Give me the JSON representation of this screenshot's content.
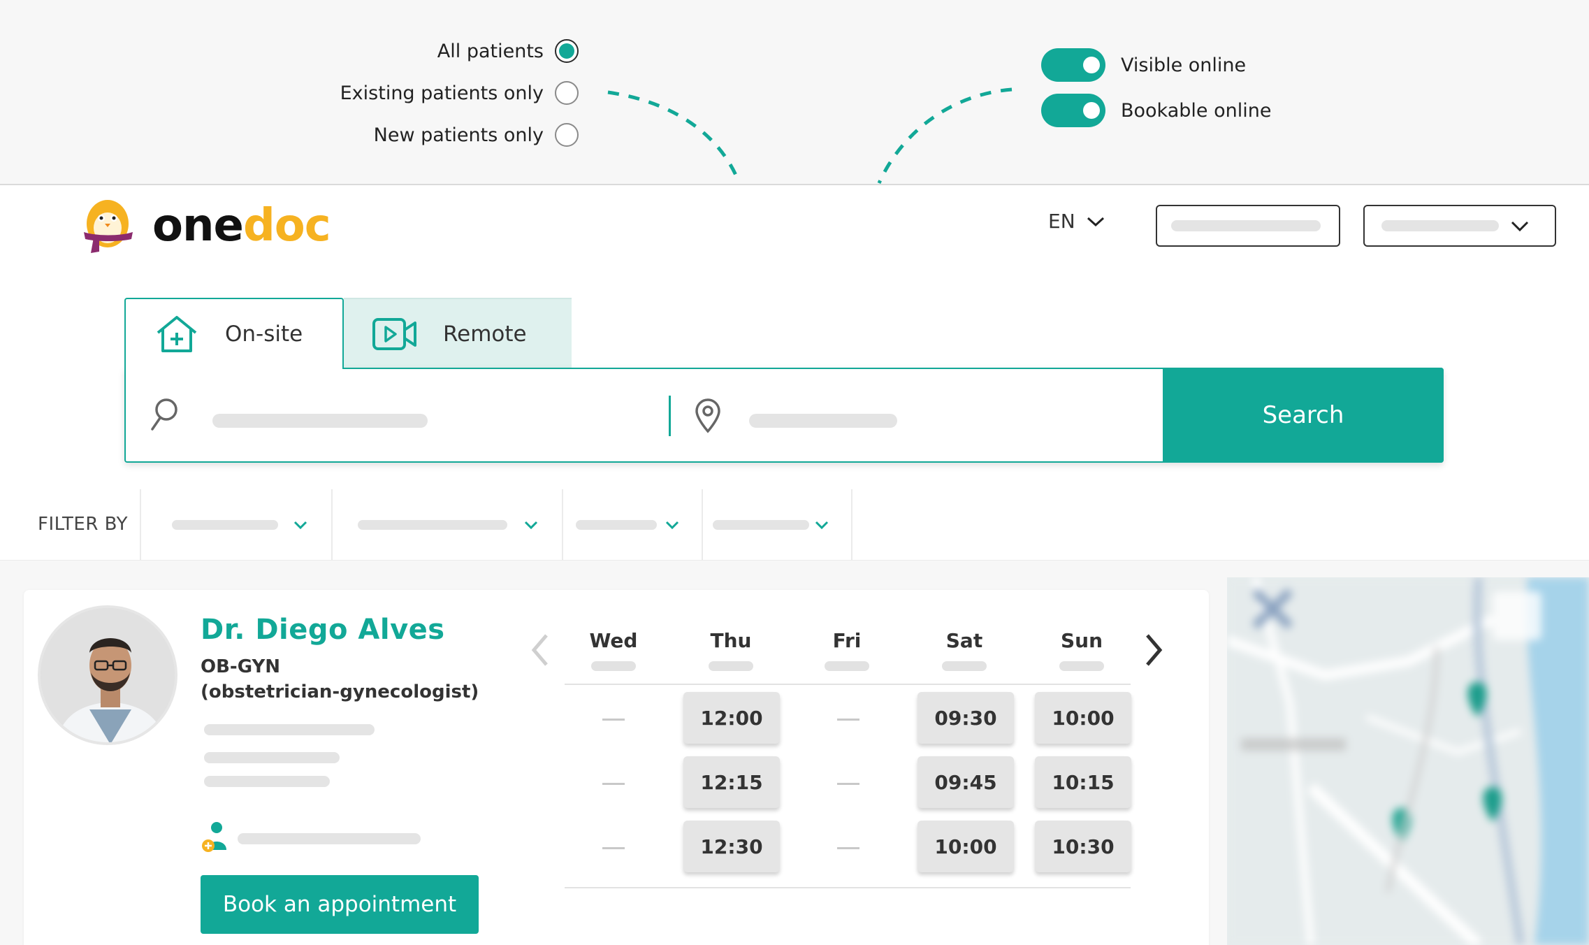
{
  "patient_filter": {
    "options": [
      {
        "label": "All patients",
        "selected": true
      },
      {
        "label": "Existing patients only",
        "selected": false
      },
      {
        "label": "New patients only",
        "selected": false
      }
    ]
  },
  "online_settings": {
    "toggles": [
      {
        "label": "Visible online",
        "on": true
      },
      {
        "label": "Bookable online",
        "on": true
      }
    ]
  },
  "header": {
    "logo": {
      "part1": "one",
      "part2": "doc"
    },
    "language": "EN"
  },
  "tabs": [
    {
      "label": "On-site",
      "icon": "house-plus-icon",
      "active": true
    },
    {
      "label": "Remote",
      "icon": "video-camera-icon",
      "active": false
    }
  ],
  "search": {
    "button_label": "Search",
    "what_icon": "search-icon",
    "where_icon": "location-pin-icon"
  },
  "filters": {
    "label": "FILTER BY"
  },
  "doctor": {
    "name": "Dr. Diego Alves",
    "specialty_line1": "OB-GYN",
    "specialty_line2": "(obstetrician-gynecologist)",
    "book_label": "Book an appointment"
  },
  "calendar": {
    "days": [
      "Wed",
      "Thu",
      "Fri",
      "Sat",
      "Sun"
    ],
    "slots": {
      "Wed": [],
      "Thu": [
        "12:00",
        "12:15",
        "12:30"
      ],
      "Fri": [],
      "Sat": [
        "09:30",
        "09:45",
        "10:00"
      ],
      "Sun": [
        "10:00",
        "10:15",
        "10:30"
      ]
    }
  },
  "colors": {
    "accent": "#12a897",
    "logo_doc": "#f6b221",
    "tab_inactive_bg": "#dff1ee"
  }
}
